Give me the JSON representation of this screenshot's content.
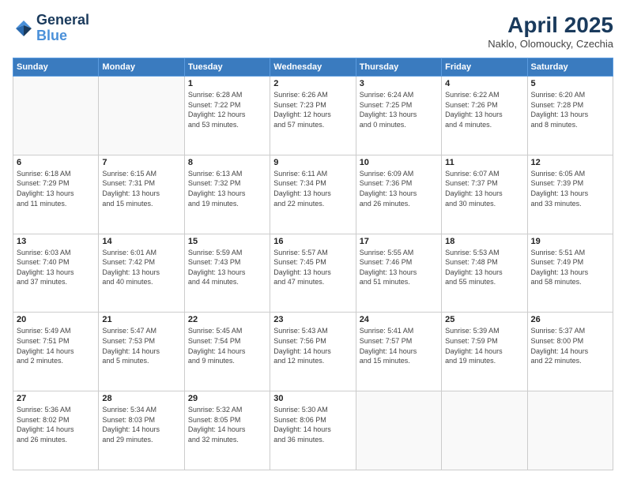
{
  "header": {
    "logo_line1": "General",
    "logo_line2": "Blue",
    "month_title": "April 2025",
    "subtitle": "Naklo, Olomoucky, Czechia"
  },
  "weekdays": [
    "Sunday",
    "Monday",
    "Tuesday",
    "Wednesday",
    "Thursday",
    "Friday",
    "Saturday"
  ],
  "weeks": [
    [
      {
        "day": "",
        "info": ""
      },
      {
        "day": "",
        "info": ""
      },
      {
        "day": "1",
        "info": "Sunrise: 6:28 AM\nSunset: 7:22 PM\nDaylight: 12 hours\nand 53 minutes."
      },
      {
        "day": "2",
        "info": "Sunrise: 6:26 AM\nSunset: 7:23 PM\nDaylight: 12 hours\nand 57 minutes."
      },
      {
        "day": "3",
        "info": "Sunrise: 6:24 AM\nSunset: 7:25 PM\nDaylight: 13 hours\nand 0 minutes."
      },
      {
        "day": "4",
        "info": "Sunrise: 6:22 AM\nSunset: 7:26 PM\nDaylight: 13 hours\nand 4 minutes."
      },
      {
        "day": "5",
        "info": "Sunrise: 6:20 AM\nSunset: 7:28 PM\nDaylight: 13 hours\nand 8 minutes."
      }
    ],
    [
      {
        "day": "6",
        "info": "Sunrise: 6:18 AM\nSunset: 7:29 PM\nDaylight: 13 hours\nand 11 minutes."
      },
      {
        "day": "7",
        "info": "Sunrise: 6:15 AM\nSunset: 7:31 PM\nDaylight: 13 hours\nand 15 minutes."
      },
      {
        "day": "8",
        "info": "Sunrise: 6:13 AM\nSunset: 7:32 PM\nDaylight: 13 hours\nand 19 minutes."
      },
      {
        "day": "9",
        "info": "Sunrise: 6:11 AM\nSunset: 7:34 PM\nDaylight: 13 hours\nand 22 minutes."
      },
      {
        "day": "10",
        "info": "Sunrise: 6:09 AM\nSunset: 7:36 PM\nDaylight: 13 hours\nand 26 minutes."
      },
      {
        "day": "11",
        "info": "Sunrise: 6:07 AM\nSunset: 7:37 PM\nDaylight: 13 hours\nand 30 minutes."
      },
      {
        "day": "12",
        "info": "Sunrise: 6:05 AM\nSunset: 7:39 PM\nDaylight: 13 hours\nand 33 minutes."
      }
    ],
    [
      {
        "day": "13",
        "info": "Sunrise: 6:03 AM\nSunset: 7:40 PM\nDaylight: 13 hours\nand 37 minutes."
      },
      {
        "day": "14",
        "info": "Sunrise: 6:01 AM\nSunset: 7:42 PM\nDaylight: 13 hours\nand 40 minutes."
      },
      {
        "day": "15",
        "info": "Sunrise: 5:59 AM\nSunset: 7:43 PM\nDaylight: 13 hours\nand 44 minutes."
      },
      {
        "day": "16",
        "info": "Sunrise: 5:57 AM\nSunset: 7:45 PM\nDaylight: 13 hours\nand 47 minutes."
      },
      {
        "day": "17",
        "info": "Sunrise: 5:55 AM\nSunset: 7:46 PM\nDaylight: 13 hours\nand 51 minutes."
      },
      {
        "day": "18",
        "info": "Sunrise: 5:53 AM\nSunset: 7:48 PM\nDaylight: 13 hours\nand 55 minutes."
      },
      {
        "day": "19",
        "info": "Sunrise: 5:51 AM\nSunset: 7:49 PM\nDaylight: 13 hours\nand 58 minutes."
      }
    ],
    [
      {
        "day": "20",
        "info": "Sunrise: 5:49 AM\nSunset: 7:51 PM\nDaylight: 14 hours\nand 2 minutes."
      },
      {
        "day": "21",
        "info": "Sunrise: 5:47 AM\nSunset: 7:53 PM\nDaylight: 14 hours\nand 5 minutes."
      },
      {
        "day": "22",
        "info": "Sunrise: 5:45 AM\nSunset: 7:54 PM\nDaylight: 14 hours\nand 9 minutes."
      },
      {
        "day": "23",
        "info": "Sunrise: 5:43 AM\nSunset: 7:56 PM\nDaylight: 14 hours\nand 12 minutes."
      },
      {
        "day": "24",
        "info": "Sunrise: 5:41 AM\nSunset: 7:57 PM\nDaylight: 14 hours\nand 15 minutes."
      },
      {
        "day": "25",
        "info": "Sunrise: 5:39 AM\nSunset: 7:59 PM\nDaylight: 14 hours\nand 19 minutes."
      },
      {
        "day": "26",
        "info": "Sunrise: 5:37 AM\nSunset: 8:00 PM\nDaylight: 14 hours\nand 22 minutes."
      }
    ],
    [
      {
        "day": "27",
        "info": "Sunrise: 5:36 AM\nSunset: 8:02 PM\nDaylight: 14 hours\nand 26 minutes."
      },
      {
        "day": "28",
        "info": "Sunrise: 5:34 AM\nSunset: 8:03 PM\nDaylight: 14 hours\nand 29 minutes."
      },
      {
        "day": "29",
        "info": "Sunrise: 5:32 AM\nSunset: 8:05 PM\nDaylight: 14 hours\nand 32 minutes."
      },
      {
        "day": "30",
        "info": "Sunrise: 5:30 AM\nSunset: 8:06 PM\nDaylight: 14 hours\nand 36 minutes."
      },
      {
        "day": "",
        "info": ""
      },
      {
        "day": "",
        "info": ""
      },
      {
        "day": "",
        "info": ""
      }
    ]
  ]
}
